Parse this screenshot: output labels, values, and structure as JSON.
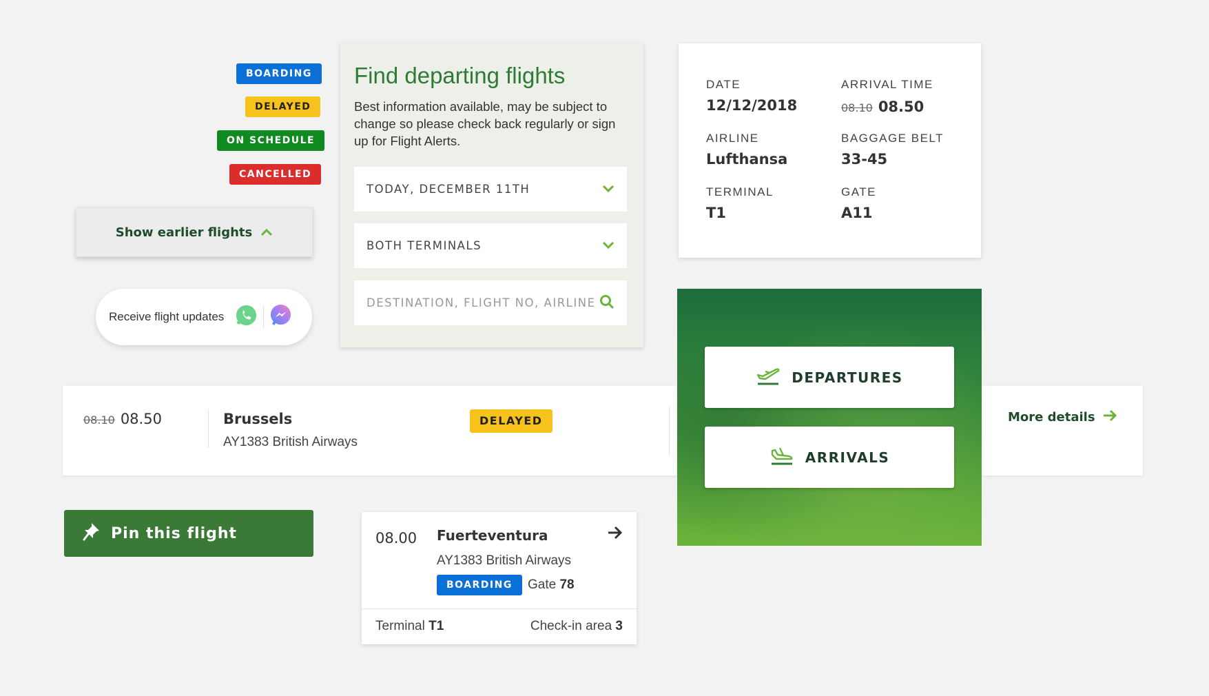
{
  "status_badges": {
    "boarding": "BOARDING",
    "delayed": "DELAYED",
    "on_schedule": "ON SCHEDULE",
    "cancelled": "CANCELLED"
  },
  "earlier_flights": {
    "label": "Show earlier flights",
    "icon": "chevron-up-icon"
  },
  "updates": {
    "label": "Receive flight updates",
    "icons": [
      "whatsapp-icon",
      "messenger-icon"
    ]
  },
  "finder": {
    "title": "Find departing flights",
    "description": "Best information available, may be subject to change so please check back regularly or sign up for Flight Alerts.",
    "date_select": "TODAY, DECEMBER 11TH",
    "terminal_select": "BOTH TERMINALS",
    "search_placeholder": "DESTINATION, FLIGHT NO, AIRLINE"
  },
  "info_card": {
    "date_label": "DATE",
    "date_value": "12/12/2018",
    "arrival_label": "ARRIVAL TIME",
    "arrival_old": "08.10",
    "arrival_new": "08.50",
    "airline_label": "AIRLINE",
    "airline_value": "Lufthansa",
    "belt_label": "BAGGAGE BELT",
    "belt_value": "33-45",
    "terminal_label": "TERMINAL",
    "terminal_value": "T1",
    "gate_label": "GATE",
    "gate_value": "A11"
  },
  "flight_row": {
    "old_time": "08.10",
    "new_time": "08.50",
    "destination": "Brussels",
    "flight": "AY1383 British Airways",
    "status": "DELAYED",
    "more": "More details"
  },
  "panel": {
    "departures": "DEPARTURES",
    "arrivals": "ARRIVALS"
  },
  "pin": {
    "label": "Pin this flight"
  },
  "flight_card": {
    "time": "08.00",
    "destination": "Fuerteventura",
    "flight": "AY1383 British Airways",
    "status": "BOARDING",
    "gate_label": "Gate",
    "gate_value": "78",
    "terminal_label": "Terminal",
    "terminal_value": "T1",
    "checkin_label": "Check-in area",
    "checkin_value": "3"
  },
  "colors": {
    "brand_green": "#2f7a36",
    "boarding_blue": "#0a6fd6",
    "delayed_yellow": "#f7c21c",
    "on_schedule_green": "#0e8a20",
    "cancelled_red": "#dc2d2d"
  }
}
